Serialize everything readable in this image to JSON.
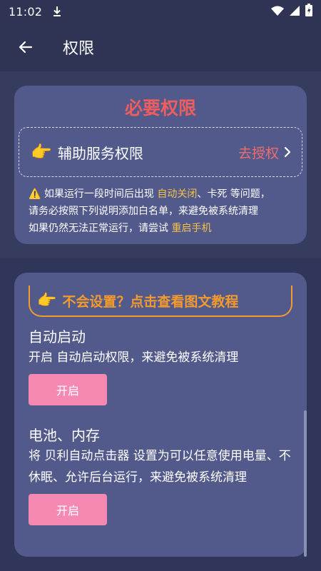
{
  "status_bar": {
    "time": "11:02",
    "icons": [
      "download-icon",
      "wifi-icon",
      "signal-icon",
      "battery-icon"
    ]
  },
  "app_bar": {
    "title": "权限",
    "back_icon": "arrow-left-icon"
  },
  "required_card": {
    "heading": "必要权限",
    "permission": {
      "icon": "👉",
      "label": "辅助服务权限",
      "action": "去授权"
    },
    "notes": {
      "warn_icon": "⚠️",
      "line1_pre": " 如果运行一段时间后出现 ",
      "line1_hl": "自动关闭",
      "line1_post": "、卡死 等问题，",
      "line2": "请务必按照下列说明添加白名单，来避免被系统清理",
      "line3_pre": "如果仍然无法正常运行，请尝试 ",
      "line3_hl": "重启手机"
    }
  },
  "settings_card": {
    "tutorial": {
      "icon": "👉",
      "text": "不会设置？点击查看图文教程"
    },
    "items": [
      {
        "title": "自动启动",
        "desc": "开启 自动启动权限，来避免被系统清理",
        "button": "开启"
      },
      {
        "title": "电池、内存",
        "desc": "将 贝利自动点击器 设置为可以任意使用电量、不休眠、允许后台运行，来避免被系统清理",
        "button": "开启"
      }
    ]
  },
  "colors": {
    "page_bg": "#363c5e",
    "bar_bg": "#2f3455",
    "card_bg": "#525a8c",
    "heading_red": "#ef5e5e",
    "highlight_yellow": "#f5c04a",
    "tutorial_orange": "#f39a2f",
    "button_pink": "#f589b2"
  }
}
